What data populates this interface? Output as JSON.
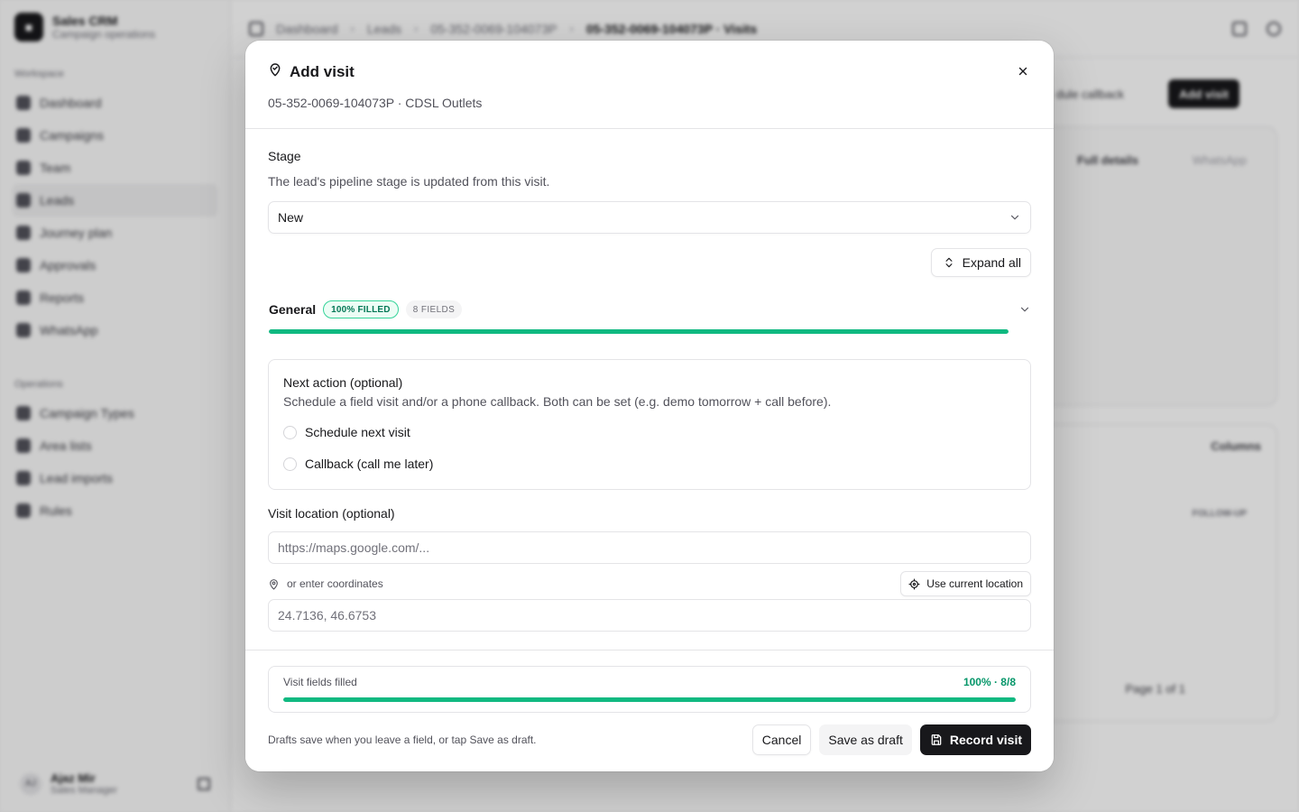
{
  "background": {
    "brand": {
      "title": "Sales CRM",
      "subtitle": "Campaign operations"
    },
    "workspace_label": "Workspace",
    "workspace_items": [
      {
        "label": "Dashboard"
      },
      {
        "label": "Campaigns"
      },
      {
        "label": "Team"
      },
      {
        "label": "Leads"
      },
      {
        "label": "Journey plan"
      },
      {
        "label": "Approvals"
      },
      {
        "label": "Reports"
      },
      {
        "label": "WhatsApp"
      }
    ],
    "operations_label": "Operations",
    "operations_items": [
      {
        "label": "Campaign Types"
      },
      {
        "label": "Area lists"
      },
      {
        "label": "Lead imports"
      },
      {
        "label": "Rules"
      }
    ],
    "user": {
      "initials": "AJ",
      "name": "Ajaz Mir",
      "role": "Sales Manager"
    },
    "breadcrumb": [
      "Dashboard",
      "Leads",
      "05-352-0069-104073P",
      "05-352-0069-104073P · Visits"
    ],
    "header_buttons": {
      "schedule": "dule callback",
      "add_visit": "Add visit"
    },
    "tabs": {
      "full_details": "Full details",
      "whatsapp": "WhatsApp"
    },
    "columns_label": "Columns",
    "follow_up_header": "FOLLOW-UP",
    "pagination": "Page 1 of 1"
  },
  "modal": {
    "title": "Add visit",
    "subtitle": "05-352-0069-104073P · CDSL Outlets",
    "stage": {
      "label": "Stage",
      "hint": "The lead's pipeline stage is updated from this visit.",
      "value": "New"
    },
    "expand_all_label": "Expand all",
    "general": {
      "title": "General",
      "filled_badge": "100% FILLED",
      "fields_badge": "8 FIELDS",
      "progress": 1.0
    },
    "next_action": {
      "title": "Next action (optional)",
      "description": "Schedule a field visit and/or a phone callback. Both can be set (e.g. demo tomorrow + call before).",
      "options": [
        {
          "label": "Schedule next visit",
          "checked": false
        },
        {
          "label": "Callback (call me later)",
          "checked": false
        }
      ]
    },
    "location": {
      "label": "Visit location (optional)",
      "url_placeholder": "https://maps.google.com/...",
      "coords_hint": "or enter coordinates",
      "use_current_label": "Use current location",
      "coords_placeholder": "24.7136, 46.6753"
    },
    "footer": {
      "fill_label": "Visit fields filled",
      "fill_count": "100% · 8/8",
      "fill_progress": 1.0,
      "note": "Drafts save when you leave a field, or tap Save as draft.",
      "cancel_label": "Cancel",
      "draft_label": "Save as draft",
      "record_label": "Record visit"
    }
  },
  "colors": {
    "accent_green": "#10b981",
    "primary": "#18181b",
    "border": "#e4e4e7"
  }
}
